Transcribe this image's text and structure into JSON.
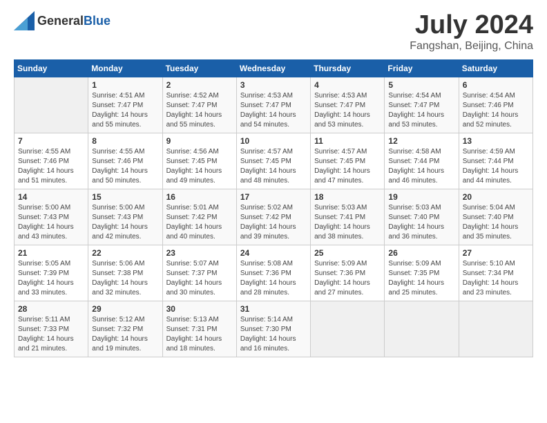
{
  "header": {
    "logo_general": "General",
    "logo_blue": "Blue",
    "main_title": "July 2024",
    "subtitle": "Fangshan, Beijing, China"
  },
  "calendar": {
    "columns": [
      "Sunday",
      "Monday",
      "Tuesday",
      "Wednesday",
      "Thursday",
      "Friday",
      "Saturday"
    ],
    "weeks": [
      [
        {
          "day": "",
          "detail": ""
        },
        {
          "day": "1",
          "detail": "Sunrise: 4:51 AM\nSunset: 7:47 PM\nDaylight: 14 hours\nand 55 minutes."
        },
        {
          "day": "2",
          "detail": "Sunrise: 4:52 AM\nSunset: 7:47 PM\nDaylight: 14 hours\nand 55 minutes."
        },
        {
          "day": "3",
          "detail": "Sunrise: 4:53 AM\nSunset: 7:47 PM\nDaylight: 14 hours\nand 54 minutes."
        },
        {
          "day": "4",
          "detail": "Sunrise: 4:53 AM\nSunset: 7:47 PM\nDaylight: 14 hours\nand 53 minutes."
        },
        {
          "day": "5",
          "detail": "Sunrise: 4:54 AM\nSunset: 7:47 PM\nDaylight: 14 hours\nand 53 minutes."
        },
        {
          "day": "6",
          "detail": "Sunrise: 4:54 AM\nSunset: 7:46 PM\nDaylight: 14 hours\nand 52 minutes."
        }
      ],
      [
        {
          "day": "7",
          "detail": "Sunrise: 4:55 AM\nSunset: 7:46 PM\nDaylight: 14 hours\nand 51 minutes."
        },
        {
          "day": "8",
          "detail": "Sunrise: 4:55 AM\nSunset: 7:46 PM\nDaylight: 14 hours\nand 50 minutes."
        },
        {
          "day": "9",
          "detail": "Sunrise: 4:56 AM\nSunset: 7:45 PM\nDaylight: 14 hours\nand 49 minutes."
        },
        {
          "day": "10",
          "detail": "Sunrise: 4:57 AM\nSunset: 7:45 PM\nDaylight: 14 hours\nand 48 minutes."
        },
        {
          "day": "11",
          "detail": "Sunrise: 4:57 AM\nSunset: 7:45 PM\nDaylight: 14 hours\nand 47 minutes."
        },
        {
          "day": "12",
          "detail": "Sunrise: 4:58 AM\nSunset: 7:44 PM\nDaylight: 14 hours\nand 46 minutes."
        },
        {
          "day": "13",
          "detail": "Sunrise: 4:59 AM\nSunset: 7:44 PM\nDaylight: 14 hours\nand 44 minutes."
        }
      ],
      [
        {
          "day": "14",
          "detail": "Sunrise: 5:00 AM\nSunset: 7:43 PM\nDaylight: 14 hours\nand 43 minutes."
        },
        {
          "day": "15",
          "detail": "Sunrise: 5:00 AM\nSunset: 7:43 PM\nDaylight: 14 hours\nand 42 minutes."
        },
        {
          "day": "16",
          "detail": "Sunrise: 5:01 AM\nSunset: 7:42 PM\nDaylight: 14 hours\nand 40 minutes."
        },
        {
          "day": "17",
          "detail": "Sunrise: 5:02 AM\nSunset: 7:42 PM\nDaylight: 14 hours\nand 39 minutes."
        },
        {
          "day": "18",
          "detail": "Sunrise: 5:03 AM\nSunset: 7:41 PM\nDaylight: 14 hours\nand 38 minutes."
        },
        {
          "day": "19",
          "detail": "Sunrise: 5:03 AM\nSunset: 7:40 PM\nDaylight: 14 hours\nand 36 minutes."
        },
        {
          "day": "20",
          "detail": "Sunrise: 5:04 AM\nSunset: 7:40 PM\nDaylight: 14 hours\nand 35 minutes."
        }
      ],
      [
        {
          "day": "21",
          "detail": "Sunrise: 5:05 AM\nSunset: 7:39 PM\nDaylight: 14 hours\nand 33 minutes."
        },
        {
          "day": "22",
          "detail": "Sunrise: 5:06 AM\nSunset: 7:38 PM\nDaylight: 14 hours\nand 32 minutes."
        },
        {
          "day": "23",
          "detail": "Sunrise: 5:07 AM\nSunset: 7:37 PM\nDaylight: 14 hours\nand 30 minutes."
        },
        {
          "day": "24",
          "detail": "Sunrise: 5:08 AM\nSunset: 7:36 PM\nDaylight: 14 hours\nand 28 minutes."
        },
        {
          "day": "25",
          "detail": "Sunrise: 5:09 AM\nSunset: 7:36 PM\nDaylight: 14 hours\nand 27 minutes."
        },
        {
          "day": "26",
          "detail": "Sunrise: 5:09 AM\nSunset: 7:35 PM\nDaylight: 14 hours\nand 25 minutes."
        },
        {
          "day": "27",
          "detail": "Sunrise: 5:10 AM\nSunset: 7:34 PM\nDaylight: 14 hours\nand 23 minutes."
        }
      ],
      [
        {
          "day": "28",
          "detail": "Sunrise: 5:11 AM\nSunset: 7:33 PM\nDaylight: 14 hours\nand 21 minutes."
        },
        {
          "day": "29",
          "detail": "Sunrise: 5:12 AM\nSunset: 7:32 PM\nDaylight: 14 hours\nand 19 minutes."
        },
        {
          "day": "30",
          "detail": "Sunrise: 5:13 AM\nSunset: 7:31 PM\nDaylight: 14 hours\nand 18 minutes."
        },
        {
          "day": "31",
          "detail": "Sunrise: 5:14 AM\nSunset: 7:30 PM\nDaylight: 14 hours\nand 16 minutes."
        },
        {
          "day": "",
          "detail": ""
        },
        {
          "day": "",
          "detail": ""
        },
        {
          "day": "",
          "detail": ""
        }
      ]
    ]
  }
}
